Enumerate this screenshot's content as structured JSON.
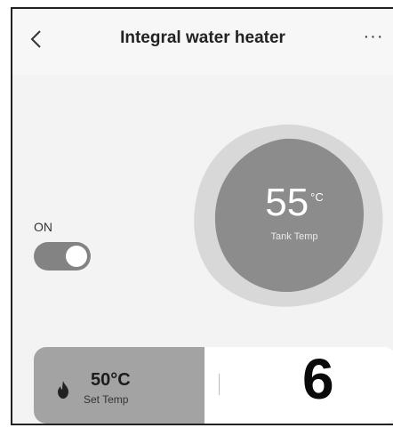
{
  "header": {
    "title": "Integral water heater",
    "back_icon": "chevron-left-icon",
    "more_icon": "more-horizontal-icon",
    "more_glyph": "···"
  },
  "tank": {
    "value": "55",
    "unit": "°C",
    "label": "Tank Temp"
  },
  "power": {
    "label": "ON",
    "state": true
  },
  "set_temp": {
    "value": "50°C",
    "label": "Set Temp",
    "icon": "flame-icon",
    "level_fraction": 0.47
  },
  "annotation": {
    "number": "6"
  },
  "colors": {
    "blob_outer": "#d8d8d8",
    "blob_inner": "#8c8c8c",
    "toggle": "#838383",
    "slider_fill": "#a3a3a3",
    "background": "#f3f3f3"
  }
}
